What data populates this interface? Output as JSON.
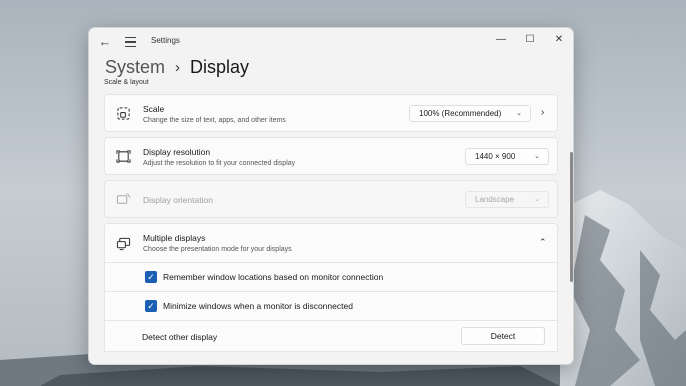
{
  "window": {
    "title": "Settings",
    "back_glyph": "←",
    "min_glyph": "—",
    "max_glyph": "☐",
    "close_glyph": "✕"
  },
  "breadcrumb": {
    "parent": "System",
    "separator": "›",
    "current": "Display"
  },
  "section_title": "Scale & layout",
  "scale": {
    "icon": "scale-icon",
    "title": "Scale",
    "description": "Change the size of text, apps, and other items",
    "value": "100% (Recommended)"
  },
  "resolution": {
    "icon": "resolution-icon",
    "title": "Display resolution",
    "description": "Adjust the resolution to fit your connected display",
    "value": "1440 × 900"
  },
  "orientation": {
    "icon": "orientation-icon",
    "title": "Display orientation",
    "value": "Landscape"
  },
  "multiple_displays": {
    "icon": "multiple-displays-icon",
    "title": "Multiple displays",
    "description": "Choose the presentation mode for your displays",
    "remember_label": "Remember window locations based on monitor connection",
    "remember_checked": true,
    "minimize_label": "Minimize windows when a monitor is disconnected",
    "minimize_checked": true,
    "detect_label": "Detect other display",
    "detect_button": "Detect"
  },
  "glyphs": {
    "chevron_down": "⌄",
    "chevron_right": "›",
    "chevron_up": "⌃",
    "check": "✓"
  },
  "colors": {
    "accent": "#1a5fb4",
    "window_bg": "#f3f3f3",
    "card_bg": "#fbfbfb"
  }
}
